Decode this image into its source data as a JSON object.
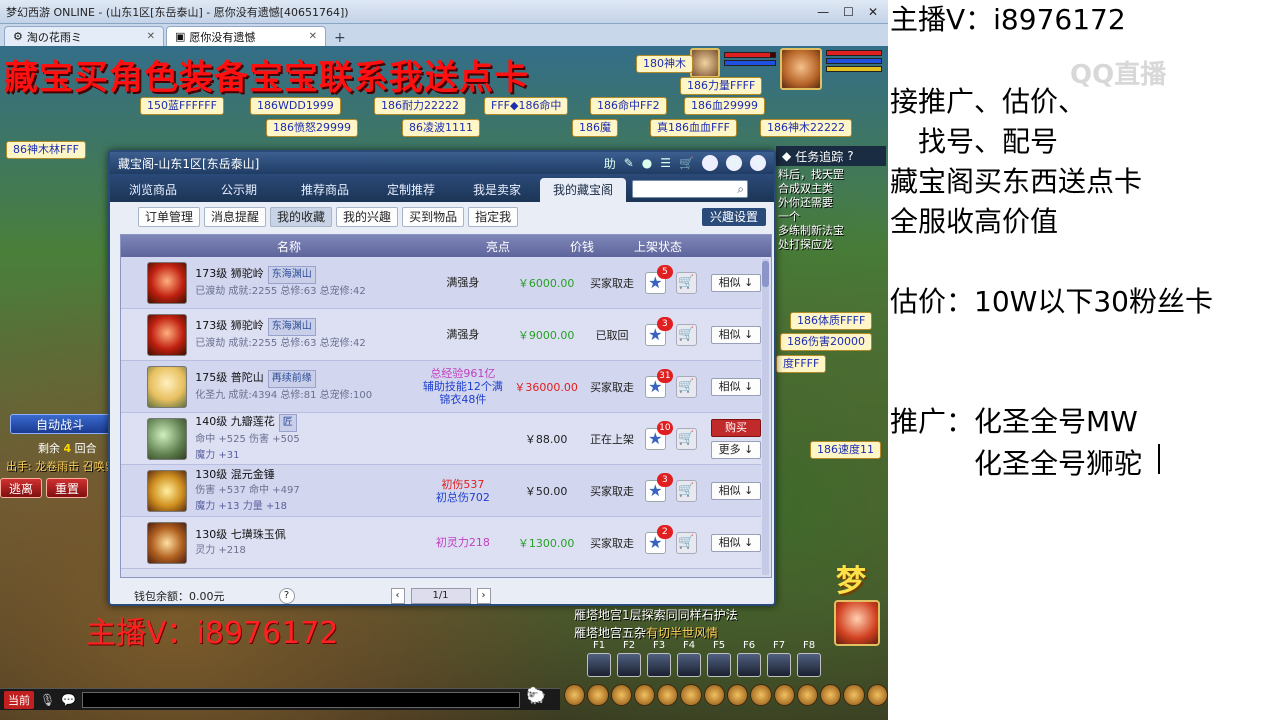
{
  "window": {
    "title": "梦幻西游 ONLINE - (山东1区[东岳泰山] - 愿你没有遗憾[40651764])",
    "tabs": [
      "淘の花雨ミ",
      "愿你没有遗憾"
    ]
  },
  "overlay": {
    "promo": "藏宝买角色装备宝宝联系我送点卡",
    "watermark": "主播V：i8976172"
  },
  "stalls": [
    "180神木",
    "186力量FFFF",
    "150蓝FFFFFF",
    "186WDD1999",
    "186耐力22222",
    "FFF◆186命中",
    "186命中FF2",
    "186血29999",
    "186愤怒29999",
    "86凌波1111",
    "186魔",
    "真186血血FFF",
    "186神木22222",
    "86神木林FFF",
    "186速度11",
    "186伤害20000",
    "186体质FFFF",
    "度FFFF"
  ],
  "game": {
    "task_title": "任务追踪",
    "task_text": [
      "料后，找天罡",
      "合成双主类",
      "外你还需要",
      "一个",
      "多练制新法宝",
      "处打探应龙"
    ],
    "auto_battle": "自动战斗",
    "rounds_prefix": "剩余",
    "rounds": "4",
    "rounds_suffix": "回合",
    "battle_info": "出手: 龙卷雨击 召唤兽:",
    "buttons": [
      "逃离",
      "重置"
    ],
    "chat1": "雁塔地宫1层探索同同样石护法",
    "chat2_prefix": "雁塔地宫五杂",
    "chat2_name": "有切半世风情",
    "chat_channel": "当前",
    "fkeys": [
      "F1",
      "F2",
      "F3",
      "F4",
      "F5",
      "F6",
      "F7",
      "F8"
    ],
    "logo": "梦"
  },
  "treasure": {
    "title": "藏宝阁-山东1区[东岳泰山]",
    "head_icons": [
      "助",
      "✎",
      "●",
      "☰",
      "🛒"
    ],
    "nav": [
      "浏览商品",
      "公示期",
      "推荐商品",
      "定制推荐",
      "我是卖家",
      "我的藏宝阁"
    ],
    "sub": [
      "订单管理",
      "消息提醒",
      "我的收藏",
      "我的兴趣",
      "买到物品",
      "指定我"
    ],
    "interest": "兴趣设置",
    "headers": [
      "名称",
      "亮点",
      "价钱",
      "上架状态"
    ],
    "rows": [
      {
        "title": "173级  狮驼岭",
        "tag": "东海渊山",
        "sub": "已渡劫 成就:2255 总修:63 总宠修:42",
        "hl": "满强身",
        "hl2": "",
        "hl3": "",
        "price": "￥6000.00",
        "status": "买家取走",
        "badge": "5",
        "actions": [
          "相似 ↓"
        ]
      },
      {
        "title": "173级  狮驼岭",
        "tag": "东海渊山",
        "sub": "已渡劫 成就:2255 总修:63 总宠修:42",
        "hl": "满强身",
        "hl2": "",
        "hl3": "",
        "price": "￥9000.00",
        "status": "已取回",
        "badge": "3",
        "actions": [
          "相似 ↓"
        ]
      },
      {
        "title": "175级  普陀山",
        "tag": "再续前缘",
        "sub": "化圣九 成就:4394 总修:81 总宠修:100",
        "hl": "总经验961亿",
        "hl2": "辅助技能12个满",
        "hl3": "锦衣48件",
        "price": "￥36000.00",
        "status": "买家取走",
        "badge": "31",
        "actions": [
          "相似 ↓"
        ]
      },
      {
        "title": "140级  九瓣莲花",
        "tag": "匠",
        "sub": "命中 +525 伤害 +505",
        "sub2": "魔力 +31",
        "hl": "",
        "hl2": "",
        "hl3": "",
        "price": "￥88.00",
        "status": "正在上架",
        "badge": "10",
        "actions": [
          "购买",
          "更多 ↓"
        ]
      },
      {
        "title": "130级  混元金锤",
        "tag": "",
        "sub": "伤害 +537 命中 +497",
        "sub2": "魔力 +13 力量 +18",
        "hl": "初伤537",
        "hl2": "初总伤702",
        "hl3": "",
        "price": "￥50.00",
        "status": "买家取走",
        "badge": "3",
        "actions": [
          "相似 ↓"
        ]
      },
      {
        "title": "130级  七璜珠玉佩",
        "tag": "",
        "sub": "灵力 +218",
        "hl": "初灵力218",
        "hl2": "",
        "hl3": "",
        "price": "￥1300.00",
        "status": "买家取走",
        "badge": "2",
        "actions": [
          "相似 ↓"
        ]
      }
    ],
    "wallet": "钱包余额：0.00元",
    "page": "1/1"
  },
  "right": {
    "lines": [
      "主播V：i8976172",
      "接推广、估价、",
      "找号、配号",
      "藏宝阁买东西送点卡",
      "全服收高价值",
      "估价：10W以下30粉丝卡",
      "推广：化圣全号MW",
      "化圣全号狮驼"
    ],
    "watermark": "QQ直播"
  }
}
